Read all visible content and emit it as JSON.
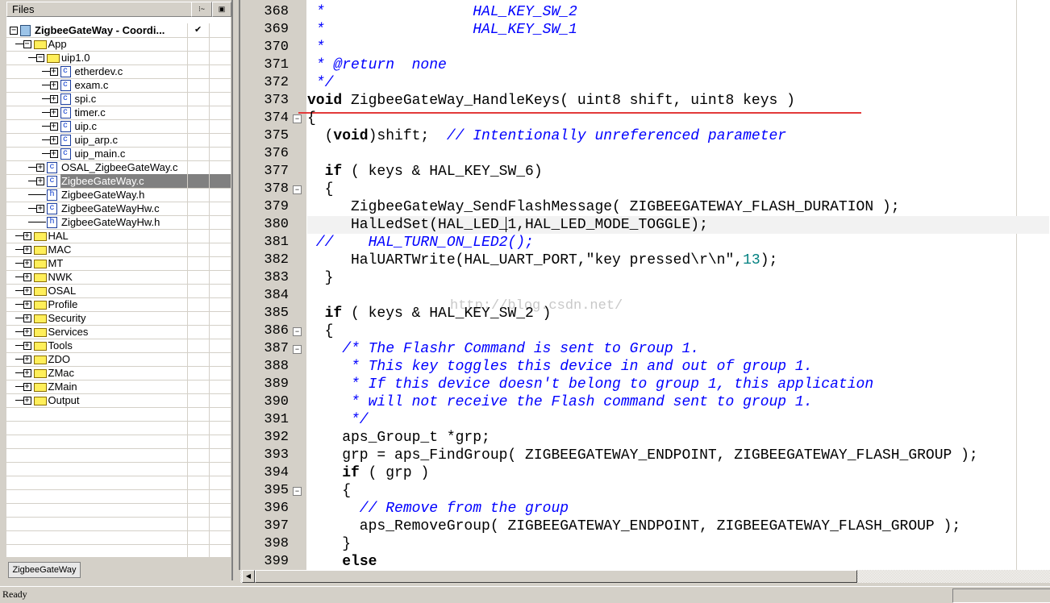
{
  "files_panel": {
    "header": "Files",
    "col2_icon": "check-options-icon",
    "col3_icon": "build-options-icon",
    "root_check": "✔",
    "items": [
      {
        "label": "ZigbeeGateWay - Coordi...",
        "level": 0,
        "type": "project",
        "exp": "-",
        "bold": true
      },
      {
        "label": "App",
        "level": 1,
        "type": "folder",
        "exp": "-"
      },
      {
        "label": "uip1.0",
        "level": 2,
        "type": "folder",
        "exp": "-"
      },
      {
        "label": "etherdev.c",
        "level": 3,
        "type": "c",
        "exp": "+"
      },
      {
        "label": "exam.c",
        "level": 3,
        "type": "c",
        "exp": "+"
      },
      {
        "label": "spi.c",
        "level": 3,
        "type": "c",
        "exp": "+"
      },
      {
        "label": "timer.c",
        "level": 3,
        "type": "c",
        "exp": "+"
      },
      {
        "label": "uip.c",
        "level": 3,
        "type": "c",
        "exp": "+"
      },
      {
        "label": "uip_arp.c",
        "level": 3,
        "type": "c",
        "exp": "+"
      },
      {
        "label": "uip_main.c",
        "level": 3,
        "type": "c",
        "exp": "+"
      },
      {
        "label": "OSAL_ZigbeeGateWay.c",
        "level": 2,
        "type": "c",
        "exp": "+"
      },
      {
        "label": "ZigbeeGateWay.c",
        "level": 2,
        "type": "c",
        "exp": "+",
        "selected": true
      },
      {
        "label": "ZigbeeGateWay.h",
        "level": 2,
        "type": "h",
        "exp": ""
      },
      {
        "label": "ZigbeeGateWayHw.c",
        "level": 2,
        "type": "c",
        "exp": "+"
      },
      {
        "label": "ZigbeeGateWayHw.h",
        "level": 2,
        "type": "h",
        "exp": ""
      },
      {
        "label": "HAL",
        "level": 1,
        "type": "folder",
        "exp": "+"
      },
      {
        "label": "MAC",
        "level": 1,
        "type": "folder",
        "exp": "+"
      },
      {
        "label": "MT",
        "level": 1,
        "type": "folder",
        "exp": "+"
      },
      {
        "label": "NWK",
        "level": 1,
        "type": "folder",
        "exp": "+"
      },
      {
        "label": "OSAL",
        "level": 1,
        "type": "folder",
        "exp": "+"
      },
      {
        "label": "Profile",
        "level": 1,
        "type": "folder",
        "exp": "+"
      },
      {
        "label": "Security",
        "level": 1,
        "type": "folder",
        "exp": "+"
      },
      {
        "label": "Services",
        "level": 1,
        "type": "folder",
        "exp": "+"
      },
      {
        "label": "Tools",
        "level": 1,
        "type": "folder",
        "exp": "+"
      },
      {
        "label": "ZDO",
        "level": 1,
        "type": "folder",
        "exp": "+"
      },
      {
        "label": "ZMac",
        "level": 1,
        "type": "folder",
        "exp": "+"
      },
      {
        "label": "ZMain",
        "level": 1,
        "type": "folder",
        "exp": "+"
      },
      {
        "label": "Output",
        "level": 1,
        "type": "folder",
        "exp": "+"
      }
    ],
    "workspace_tab": "ZigbeeGateWay"
  },
  "editor": {
    "current_line": 380,
    "watermark": "http://blog.csdn.net/",
    "colors": {
      "keyword": "#000000",
      "comment": "#0000ff",
      "number": "#008080",
      "annotation_line": "#e23a3a"
    },
    "lines": [
      {
        "n": "368",
        "t": [
          [
            " *                 HAL_KEY_SW_2",
            "c"
          ]
        ]
      },
      {
        "n": "369",
        "t": [
          [
            " *                 HAL_KEY_SW_1",
            "c"
          ]
        ]
      },
      {
        "n": "370",
        "t": [
          [
            " *",
            "c"
          ]
        ]
      },
      {
        "n": "371",
        "t": [
          [
            " * @return  none",
            "c"
          ]
        ]
      },
      {
        "n": "372",
        "t": [
          [
            " */",
            "c"
          ]
        ]
      },
      {
        "n": "373",
        "t": [
          [
            "void",
            "k"
          ],
          [
            " ZigbeeGateWay_HandleKeys( uint8 shift, uint8 keys )",
            ""
          ]
        ]
      },
      {
        "n": "374",
        "fold": true,
        "t": [
          [
            "{",
            ""
          ]
        ]
      },
      {
        "n": "375",
        "t": [
          [
            "  (",
            ""
          ],
          [
            "void",
            "k"
          ],
          [
            ")shift;  ",
            ""
          ],
          [
            "// Intentionally unreferenced parameter",
            "c"
          ]
        ]
      },
      {
        "n": "376",
        "t": []
      },
      {
        "n": "377",
        "t": [
          [
            "  ",
            ""
          ],
          [
            "if",
            "k"
          ],
          [
            " ( keys & HAL_KEY_SW_6)",
            ""
          ]
        ]
      },
      {
        "n": "378",
        "fold": true,
        "t": [
          [
            "  {",
            ""
          ]
        ]
      },
      {
        "n": "379",
        "t": [
          [
            "     ZigbeeGateWay_SendFlashMessage( ZIGBEEGATEWAY_FLASH_DURATION );",
            ""
          ]
        ]
      },
      {
        "n": "380",
        "t": [
          [
            "     HalLedSet(HAL_LED_1,HAL_LED_MODE_TOGGLE);",
            ""
          ]
        ]
      },
      {
        "n": "381",
        "t": [
          [
            " //    HAL_TURN_ON_LED2();",
            "c"
          ]
        ]
      },
      {
        "n": "382",
        "t": [
          [
            "     HalUARTWrite(HAL_UART_PORT,\"key pressed\\r\\n\",",
            ""
          ],
          [
            "13",
            "n"
          ],
          [
            ");",
            ""
          ]
        ]
      },
      {
        "n": "383",
        "t": [
          [
            "  }",
            ""
          ]
        ]
      },
      {
        "n": "384",
        "t": []
      },
      {
        "n": "385",
        "t": [
          [
            "  ",
            ""
          ],
          [
            "if",
            "k"
          ],
          [
            " ( keys & HAL_KEY_SW_2 )",
            ""
          ]
        ]
      },
      {
        "n": "386",
        "fold": true,
        "t": [
          [
            "  {",
            ""
          ]
        ]
      },
      {
        "n": "387",
        "fold": true,
        "t": [
          [
            "    /* The Flashr Command is sent to Group 1.",
            "c"
          ]
        ]
      },
      {
        "n": "388",
        "t": [
          [
            "     * This key toggles this device in and out of group 1.",
            "c"
          ]
        ]
      },
      {
        "n": "389",
        "t": [
          [
            "     * If this device doesn't belong to group 1, this application",
            "c"
          ]
        ]
      },
      {
        "n": "390",
        "t": [
          [
            "     * will not receive the Flash command sent to group 1.",
            "c"
          ]
        ]
      },
      {
        "n": "391",
        "t": [
          [
            "     */",
            "c"
          ]
        ]
      },
      {
        "n": "392",
        "t": [
          [
            "    aps_Group_t *grp;",
            ""
          ]
        ]
      },
      {
        "n": "393",
        "t": [
          [
            "    grp = aps_FindGroup( ZIGBEEGATEWAY_ENDPOINT, ZIGBEEGATEWAY_FLASH_GROUP );",
            ""
          ]
        ]
      },
      {
        "n": "394",
        "t": [
          [
            "    ",
            ""
          ],
          [
            "if",
            "k"
          ],
          [
            " ( grp )",
            ""
          ]
        ]
      },
      {
        "n": "395",
        "fold": true,
        "t": [
          [
            "    {",
            ""
          ]
        ]
      },
      {
        "n": "396",
        "t": [
          [
            "      // Remove from the group",
            "c"
          ]
        ]
      },
      {
        "n": "397",
        "t": [
          [
            "      aps_RemoveGroup( ZIGBEEGATEWAY_ENDPOINT, ZIGBEEGATEWAY_FLASH_GROUP );",
            ""
          ]
        ]
      },
      {
        "n": "398",
        "t": [
          [
            "    }",
            ""
          ]
        ]
      },
      {
        "n": "399",
        "t": [
          [
            "    ",
            ""
          ],
          [
            "else",
            "k"
          ]
        ]
      }
    ]
  },
  "status_bar": {
    "text": "Ready"
  }
}
